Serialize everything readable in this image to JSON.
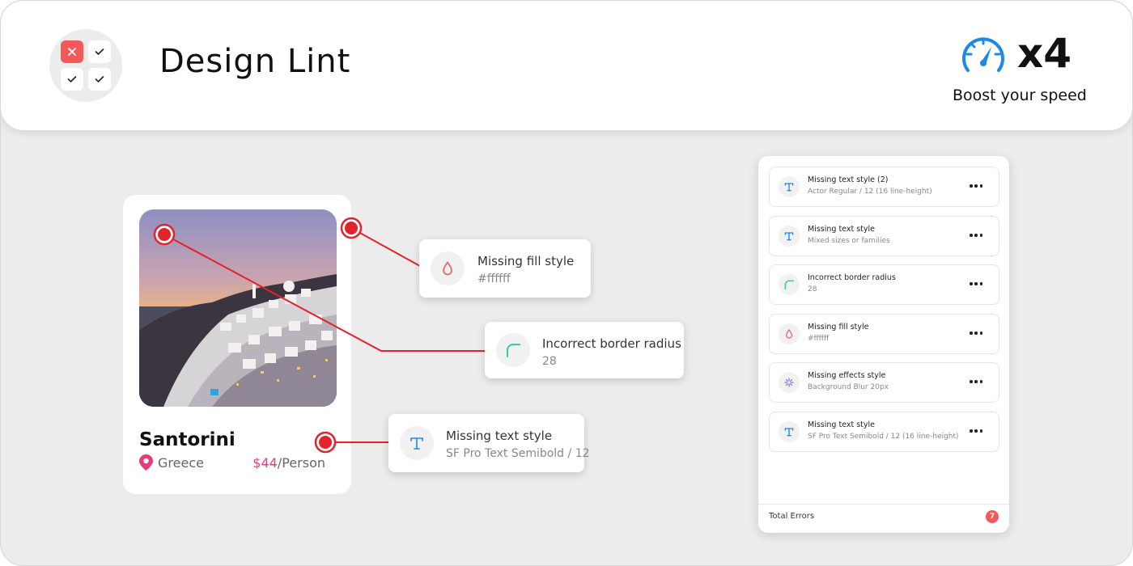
{
  "app": {
    "title": "Design Lint"
  },
  "speed": {
    "value": "x4",
    "subtitle": "Boost your speed"
  },
  "card": {
    "place": "Santorini",
    "country": "Greece",
    "price_amount": "$44",
    "price_unit": "/Person"
  },
  "callouts": [
    {
      "title": "Missing fill style",
      "detail": "#ffffff",
      "icon": "droplet-icon"
    },
    {
      "title": "Incorrect border radius",
      "detail": "28",
      "icon": "border-radius-icon"
    },
    {
      "title": "Missing text style",
      "detail": "SF Pro Text Semibold / 12",
      "icon": "text-style-icon"
    }
  ],
  "errors": [
    {
      "title": "Missing text style (2)",
      "detail": "Actor Regular / 12 (16 line-height)",
      "icon": "text-style-icon"
    },
    {
      "title": "Missing text style",
      "detail": "Mixed sizes or families",
      "icon": "text-style-icon"
    },
    {
      "title": "Incorrect border radius",
      "detail": "28",
      "icon": "border-radius-icon"
    },
    {
      "title": "Missing fill style",
      "detail": "#ffffff",
      "icon": "droplet-icon"
    },
    {
      "title": "Missing effects style",
      "detail": "Background Blur 20px",
      "icon": "effects-icon"
    },
    {
      "title": "Missing text style",
      "detail": "SF Pro Text Semibold / 12 (16 line-height)",
      "icon": "text-style-icon"
    }
  ],
  "footer": {
    "label": "Total Errors",
    "count": "7"
  },
  "colors": {
    "error_red": "#e3222a",
    "badge_red": "#f25a5a",
    "accent_blue": "#1e88e5",
    "accent_teal": "#2ecfa0",
    "price_pink": "#e63c7c"
  }
}
